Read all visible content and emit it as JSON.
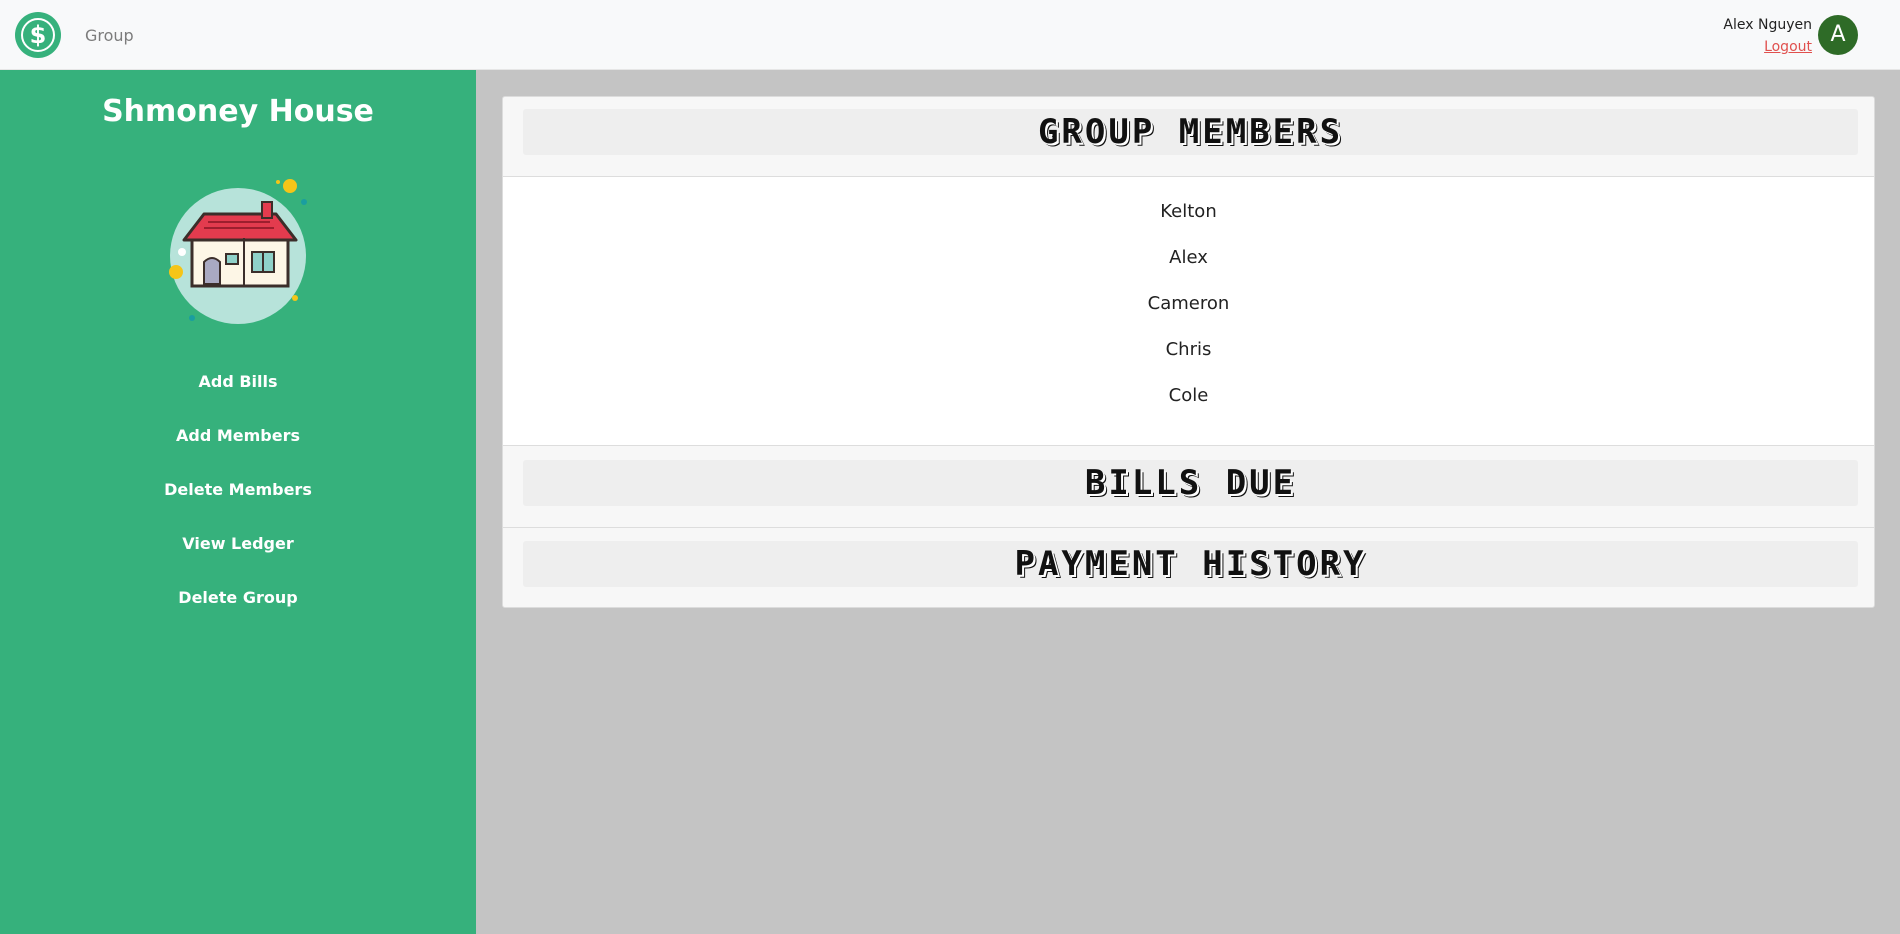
{
  "navbar": {
    "logo_icon": "dollar-sign-logo",
    "nav_link": "Group",
    "user_name": "Alex Nguyen",
    "logout_label": "Logout",
    "avatar_initial": "A"
  },
  "sidebar": {
    "group_name": "Shmoney House",
    "illustration": "house-illustration",
    "menu": [
      {
        "label": "Add Bills"
      },
      {
        "label": "Add Members"
      },
      {
        "label": "Delete Members"
      },
      {
        "label": "View Ledger"
      },
      {
        "label": "Delete Group"
      }
    ]
  },
  "main": {
    "sections": {
      "members": {
        "title": "GROUP MEMBERS"
      },
      "bills": {
        "title": "BILLS DUE"
      },
      "history": {
        "title": "PAYMENT HISTORY"
      }
    },
    "members": [
      "Kelton",
      "Alex",
      "Cameron",
      "Chris",
      "Cole"
    ]
  },
  "colors": {
    "brand_green": "#36b17c",
    "avatar_green": "#2e6b27",
    "logout_red": "#e0504e",
    "page_background": "#c4c4c4"
  }
}
